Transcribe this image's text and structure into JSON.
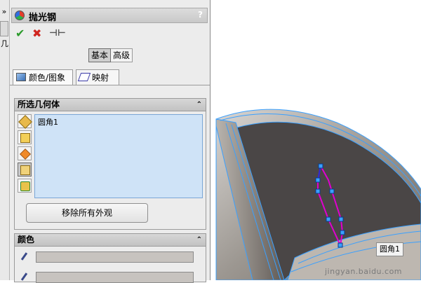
{
  "left_strip": {
    "chevron": "»",
    "char": "几"
  },
  "panel": {
    "title": "抛光钢",
    "help": "?",
    "actions": {
      "ok": "✔",
      "cancel": "✖",
      "pin": "⊣⊢"
    },
    "modes": [
      "基本",
      "高级"
    ],
    "tabs": [
      "颜色/图象",
      "映射"
    ],
    "selection": {
      "header": "所选几何体",
      "items": [
        "圆角1"
      ],
      "remove_label": "移除所有外观"
    },
    "color": {
      "header": "颜色"
    }
  },
  "viewport": {
    "tag_label": "圆角1",
    "watermark": "jingyan.baidu.com"
  },
  "colors": {
    "panel_bg": "#ececec",
    "list_bg": "#cfe3f7",
    "edge_blue": "#3aa0ff",
    "sketch_magenta": "#e000d0",
    "face_dark": "#4a4646"
  }
}
